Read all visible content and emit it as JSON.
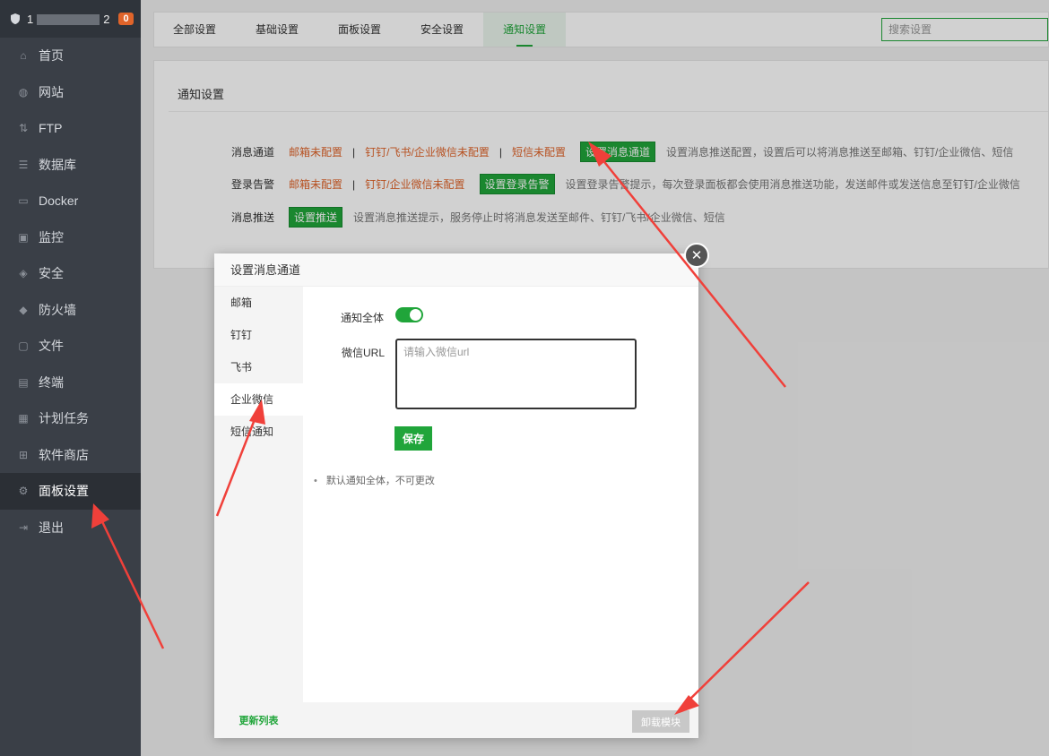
{
  "sidebar": {
    "host_prefix": "1",
    "host_suffix": "2",
    "notification_count": "0",
    "items": [
      {
        "label": "首页",
        "icon": "home-icon"
      },
      {
        "label": "网站",
        "icon": "globe-icon"
      },
      {
        "label": "FTP",
        "icon": "ftp-icon"
      },
      {
        "label": "数据库",
        "icon": "database-icon"
      },
      {
        "label": "Docker",
        "icon": "docker-icon"
      },
      {
        "label": "监控",
        "icon": "monitor-icon"
      },
      {
        "label": "安全",
        "icon": "shield-icon"
      },
      {
        "label": "防火墙",
        "icon": "firewall-icon"
      },
      {
        "label": "文件",
        "icon": "folder-icon"
      },
      {
        "label": "终端",
        "icon": "terminal-icon"
      },
      {
        "label": "计划任务",
        "icon": "calendar-icon"
      },
      {
        "label": "软件商店",
        "icon": "apps-icon"
      },
      {
        "label": "面板设置",
        "icon": "gear-icon",
        "active": true
      },
      {
        "label": "退出",
        "icon": "logout-icon"
      }
    ]
  },
  "tabs": [
    "全部设置",
    "基础设置",
    "面板设置",
    "安全设置",
    "通知设置"
  ],
  "active_tab": "通知设置",
  "search": {
    "placeholder": "搜索设置"
  },
  "panel": {
    "title": "通知设置",
    "rows": {
      "channel": {
        "label": "消息通道",
        "items": [
          "邮箱未配置",
          "钉钉/飞书/企业微信未配置",
          "短信未配置"
        ],
        "button": "设置消息通道",
        "hint": "设置消息推送配置，设置后可以将消息推送至邮箱、钉钉/企业微信、短信"
      },
      "login_alert": {
        "label": "登录告警",
        "items": [
          "邮箱未配置",
          "钉钉/企业微信未配置"
        ],
        "button": "设置登录告警",
        "hint": "设置登录告警提示，每次登录面板都会使用消息推送功能，发送邮件或发送信息至钉钉/企业微信"
      },
      "push": {
        "label": "消息推送",
        "button": "设置推送",
        "hint": "设置消息推送提示，服务停止时将消息发送至邮件、钉钉/飞书/企业微信、短信"
      }
    }
  },
  "modal": {
    "title": "设置消息通道",
    "close_symbol": "✕",
    "menu": [
      "邮箱",
      "钉钉",
      "飞书",
      "企业微信",
      "短信通知"
    ],
    "active_menu": "企业微信",
    "refresh_label": "更新列表",
    "notify_all_label": "通知全体",
    "notify_all_on": true,
    "url_label": "微信URL",
    "url_placeholder": "请输入微信url",
    "url_value": "",
    "save_label": "保存",
    "note": "默认通知全体，不可更改",
    "uninstall_label": "卸载模块"
  },
  "colors": {
    "accent": "#20a53a",
    "warning": "#e0642a",
    "sidebar_bg": "#3a3f47",
    "annotation_arrow": "#f0403a"
  }
}
